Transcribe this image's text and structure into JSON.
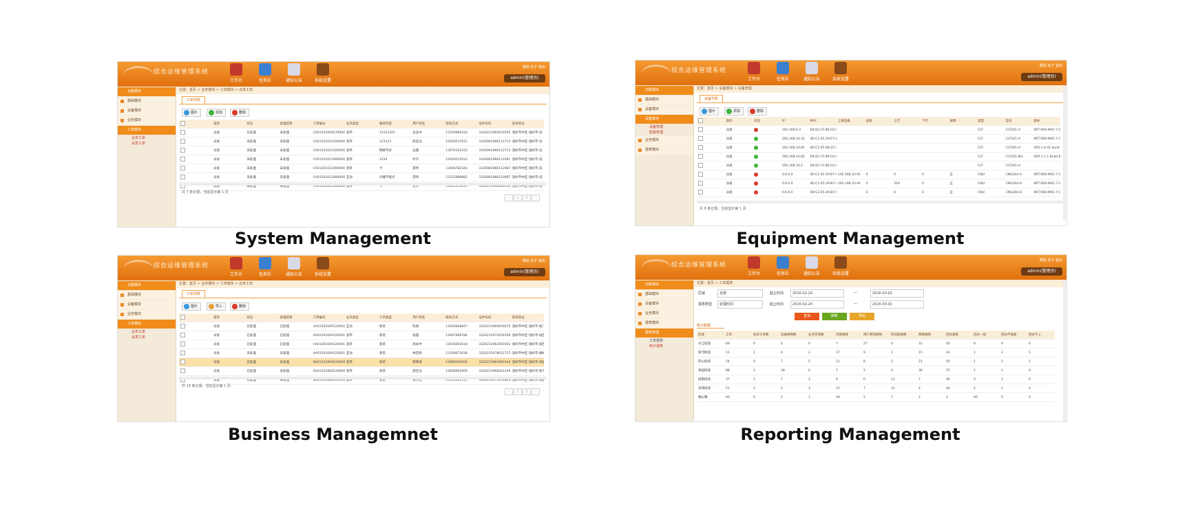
{
  "captions": {
    "system": "System Management",
    "equipment": "Equipment Management",
    "business": "Business Managemnet",
    "reporting": "Reporting Management"
  },
  "app": {
    "logo_text": "综合运维管理系统",
    "nav": [
      "工作台",
      "任务栏",
      "通知公告",
      "系统设置"
    ],
    "top_links": "帮助  关于  退出",
    "user": "admin(管理员)"
  },
  "colors": {
    "brand_orange": "#f08c1a",
    "header_dark": "#e0700e",
    "highlight_row": "#fbe0a8",
    "led_red": "#d93c2b",
    "led_green": "#3cb43c"
  },
  "system": {
    "sidebar": [
      "功能模块",
      "基础模块",
      "设备模块",
      "业务模块",
      "工单模块",
      "业务工单",
      "派发工单"
    ],
    "crumb": "位置：首页 > 业务模块 > 工单模块 > 派发工单",
    "tab": "工单列表",
    "buttons": [
      "图片",
      "添加",
      "删除"
    ],
    "columns": [
      "",
      "操作",
      "状态",
      "处理结果",
      "工单编号",
      "业务类型",
      "报修内容",
      "用户姓名",
      "联系方式",
      "证件号码",
      "安装地址"
    ],
    "rows": [
      [
        "",
        "派发",
        "已处理",
        "未处理",
        "CA0120160927000002",
        "宽带",
        "12312321",
        "吴业中",
        "13559885618",
        "332623196505250511",
        "温岭市中区-温岭市-滨"
      ],
      [
        "",
        "派发",
        "未处理",
        "未处理",
        "CA0120161010000001",
        "宽带",
        "123123",
        "陈桂法",
        "15818537612",
        "332608198011271193",
        "温岭市中区-温岭市-滨"
      ],
      [
        "",
        "派发",
        "未处理",
        "未处理",
        "CA0120161010000001",
        "宽带",
        "网络不好",
        "吴霞",
        "13676332233",
        "332608198011271193",
        "温岭市中区-温岭市-滨"
      ],
      [
        "",
        "派发",
        "未处理",
        "未处理",
        "CA0120161109000002",
        "宽带",
        "1234",
        "朴宁",
        "15818537612",
        "332608198011208111",
        "温岭市中区-温岭市-滨"
      ],
      [
        "",
        "派发",
        "未处理",
        "未处理",
        "CA0120161109000004",
        "宽带",
        "卡",
        "游伟",
        "13666782343",
        "332608198011208762",
        "温岭市中区-温岭市-滨"
      ],
      [
        "",
        "派发",
        "未处理",
        "未处理",
        "CA0120161109000005",
        "互动",
        "点播不能点",
        "游伟",
        "13332989982",
        "332608198011098721",
        "温岭市中区-温岭市-滨"
      ],
      [
        "",
        "派发",
        "未处理",
        "未处理",
        "CA0120161109000006",
        "宽带",
        "卡",
        "龙三",
        "13321213121",
        "332620199008101021",
        "温岭市中区-温岭市-滨"
      ]
    ],
    "pager": "共 7 条记录，当前显示第 1 页",
    "pager_btns": [
      "‹",
      "1",
      "2",
      "›"
    ]
  },
  "equipment": {
    "sidebar": [
      "功能模块",
      "基础模块",
      "设备模块",
      "设备模块",
      "设备管理",
      "配置管理",
      "业务模块",
      "报表模块"
    ],
    "crumb": "位置：首页 > 设备模块 > 设备管理",
    "tab": "设备列表",
    "buttons": [
      "图片",
      "添加",
      "删除"
    ],
    "columns": [
      "",
      "操作",
      "状态",
      "IP",
      "MAC",
      "上联设备",
      "层级",
      "上行",
      "下行",
      "故障",
      "类型",
      "型号",
      "版本"
    ],
    "rows": [
      [
        "",
        "派发",
        "red",
        "192.168.0.3",
        "D4:EE:CF:0B:CA:A2",
        "",
        "",
        "",
        "",
        "",
        "CLT",
        "CLT201-H",
        "INT7400-MAC-7-0-7001-14-31-20110706-FINAL-C"
      ],
      [
        "",
        "派发",
        "green",
        "192.168.10.33",
        "4D:C2:45:29:E7:B7",
        "",
        "",
        "",
        "",
        "",
        "CLT",
        "CLT201-H",
        "INT7400-MAC-7-0-7001-14-31-20110706-FINAL-C"
      ],
      [
        "",
        "派发",
        "green",
        "192.168.10.81",
        "4D:C2:45:08:22:7A",
        "",
        "",
        "",
        "",
        "",
        "CLT",
        "CLT201-H",
        "VER 1.0.41 build 5820"
      ],
      [
        "",
        "派发",
        "green",
        "192.168.10.82",
        "D4:EE:CF:0B:CA:A1",
        "",
        "",
        "",
        "",
        "",
        "CLT",
        "CLT201-N/L",
        "VER 1.1.1 Build 8080"
      ],
      [
        "",
        "派发",
        "green",
        "192.168.10.2",
        "D4:EE:CF:0B:CA:A8",
        "",
        "",
        "",
        "",
        "",
        "CLT",
        "CLT201-H",
        ""
      ],
      [
        "",
        "派发",
        "red",
        "0.0.0.0",
        "4D:C2:45:29:B7:A9",
        "192.168.10.91",
        "0",
        "0",
        "0",
        "正",
        "CNU",
        "CNU204-H",
        "INT7400-MAC-7-0-7001-14-31-20110706-FINAL-C"
      ],
      [
        "",
        "派发",
        "red",
        "0.0.0.0",
        "4D:C2:45:29:B7:A7",
        "192.168.10.92",
        "0",
        "319",
        "0",
        "正",
        "CNU",
        "CNU204-H",
        "INT7400-MAC-7-0-7001-14-31-20110706-FINAL-C"
      ],
      [
        "",
        "派发",
        "red",
        "0.0.0.0",
        "4D:C2:45:29:B7:05",
        "",
        "0",
        "0",
        "0",
        "正",
        "CNU",
        "CNU204-H",
        "INT7400-MAC-7-0-7001-14-31-20110706-FINAL-C"
      ]
    ],
    "pager": "共 8 条记录，当前显示第 1 页"
  },
  "business": {
    "sidebar": [
      "功能模块",
      "基础模块",
      "设备模块",
      "业务模块",
      "工单模块",
      "业务工单",
      "派发工单"
    ],
    "crumb": "位置：首页 > 业务模块 > 工单模块 > 业务工单",
    "tab": "工单列表",
    "buttons": [
      "图片",
      "导入",
      "删除"
    ],
    "columns": [
      "",
      "操作",
      "状态",
      "处理结果",
      "工单编号",
      "业务类型",
      "工单类型",
      "用户姓名",
      "联系方式",
      "证件号码",
      "安装地址"
    ],
    "rows": [
      [
        "",
        "派发",
        "已处理",
        "已处理",
        "AA0120160912000245",
        "互动",
        "新装",
        "陈刚",
        "13456668847",
        "332623196905007553",
        "温岭市中区-温岭市-松门镇-小区-江南明珠-16-706"
      ],
      [
        "",
        "派发",
        "已处理",
        "已处理",
        "AA0120160912000123",
        "宽带",
        "新装",
        "张磊",
        "13667668786",
        "332623197203220091",
        "温岭市中区-温岭市-城西街道-小区-嘉枫世纪-南区1-"
      ],
      [
        "",
        "派发",
        "已处理",
        "已处理",
        "AA0120160912000133",
        "宽带",
        "新装",
        "周永中",
        "13656693618",
        "332623196305030311",
        "温岭市中区-温岭市-城西街道-小区-嘉枫花园南区-1-"
      ],
      [
        "",
        "派发",
        "未处理",
        "未处理",
        "AA0120160912000132",
        "互动",
        "新装",
        "林定辉",
        "13358675638",
        "332623197801272768",
        "温岭市中区-温岭市-横峰街道-村落-横峰村-阳光大道"
      ],
      [
        "",
        "派发",
        "已处理",
        "未处理",
        "DA0120160912000030",
        "宽带",
        "新装",
        "蔡明海",
        "13988450208",
        "332623196208034434",
        "温岭市中区-温岭市-泽国镇-村落-下周村-下周路-4-3"
      ],
      [
        "",
        "派发",
        "已处理",
        "未处理",
        "DA0120160912000071",
        "宽带",
        "新装",
        "邵宝法",
        "13656692600",
        "332623196604124913",
        "温岭市中区-温岭市-新河镇-塘下村-下塘村-一组公路"
      ],
      [
        "",
        "派发",
        "已处理",
        "未处理",
        "DA0120160912000070",
        "宽带",
        "新装",
        "黄小红",
        "15551021111",
        "332623197101184345",
        "温岭市中区-温岭市-泽国镇-村落-泽国-北郊-北郊区16号"
      ]
    ],
    "pager": "共 14 条记录，当前显示第 1 页",
    "pager_btns": [
      "‹",
      "1",
      "2",
      "›"
    ]
  },
  "reporting": {
    "sidebar": [
      "功能模块",
      "基础模块",
      "设备模块",
      "业务模块",
      "报表模块",
      "报表管理",
      "工单报表",
      "统计报表"
    ],
    "crumb": "位置：首页 > 工单报表",
    "filters": {
      "area_label": "区域",
      "area_value": "全部",
      "report_label": "报表类型",
      "report_value": "处理时间",
      "start_label": "起止时间",
      "start_1": "2016-02-24",
      "end_1": "2016-03-01",
      "start_2": "2016-02-24",
      "end_2": "2016-03-01",
      "dash": "—"
    },
    "buttons": [
      "查询",
      "刷新",
      "导出"
    ],
    "stat_title": "统计数据",
    "columns": [
      "区域",
      "工单",
      "投诉工单数",
      "设备故障数",
      "业务咨询数",
      "内部故障",
      "用户原因故障",
      "机顶盒故障",
      "网络故障",
      "回访满意",
      "回访一般",
      "回访不满意",
      "回访不上"
    ],
    "rows": [
      [
        "分江街道",
        "69",
        "0",
        "4",
        "0",
        "7",
        "27",
        "0",
        "31",
        "65",
        "0",
        "0",
        "4"
      ],
      [
        "新河街道",
        "51",
        "1",
        "6",
        "2",
        "17",
        "9",
        "1",
        "15",
        "43",
        "1",
        "2",
        "5"
      ],
      [
        "四山街道",
        "54",
        "0",
        "7",
        "5",
        "11",
        "8",
        "2",
        "21",
        "50",
        "1",
        "2",
        "1"
      ],
      [
        "泽国街道",
        "88",
        "2",
        "18",
        "0",
        "7",
        "5",
        "0",
        "36",
        "75",
        "1",
        "1",
        "9"
      ],
      [
        "城南街道",
        "37",
        "1",
        "7",
        "3",
        "6",
        "0",
        "13",
        "7",
        "36",
        "0",
        "1",
        "0"
      ],
      [
        "滨海街道",
        "51",
        "2",
        "5",
        "3",
        "15",
        "7",
        "15",
        "4",
        "44",
        "2",
        "1",
        "4"
      ],
      [
        "横山镇",
        "40",
        "6",
        "4",
        "1",
        "18",
        "2",
        "7",
        "2",
        "1",
        "40",
        "0",
        "0"
      ]
    ]
  }
}
